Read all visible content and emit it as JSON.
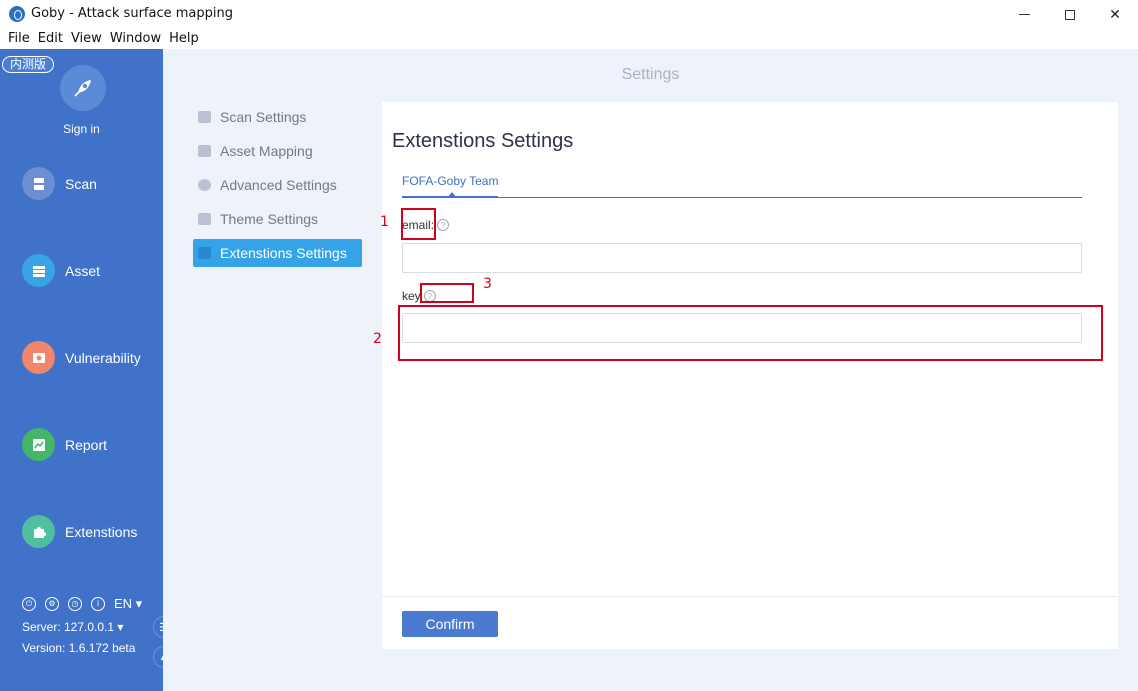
{
  "window": {
    "title": "Goby - Attack surface mapping",
    "controls": {
      "minimize": "─",
      "maximize": "☐",
      "close": "✕"
    }
  },
  "menubar": [
    "File",
    "Edit",
    "View",
    "Window",
    "Help"
  ],
  "sidebar": {
    "badge": "内测版",
    "signin": "Sign in",
    "nav": [
      {
        "label": "Scan",
        "icon": "scan-icon",
        "color": "#6b8fd0"
      },
      {
        "label": "Asset",
        "icon": "asset-icon",
        "color": "#3aa3e6"
      },
      {
        "label": "Vulnerability",
        "icon": "vulnerability-icon",
        "color": "#f0866a"
      },
      {
        "label": "Report",
        "icon": "report-icon",
        "color": "#45b56a"
      },
      {
        "label": "Extenstions",
        "icon": "extensions-icon",
        "color": "#4fbf9f"
      }
    ],
    "tools": {
      "language": "EN"
    },
    "server": "Server: 127.0.0.1",
    "version": "Version: 1.6.172 beta"
  },
  "main": {
    "page_title": "Settings",
    "subnav": [
      {
        "label": "Scan Settings",
        "active": false
      },
      {
        "label": "Asset Mapping",
        "active": false
      },
      {
        "label": "Advanced Settings",
        "active": false
      },
      {
        "label": "Theme Settings",
        "active": false
      },
      {
        "label": "Extenstions Settings",
        "active": true
      }
    ],
    "card": {
      "title": "Extenstions Settings",
      "tab": "FOFA-Goby Team",
      "email_label": "email",
      "email_value": "",
      "key_label": "key",
      "key_value": "",
      "confirm": "Confirm"
    }
  },
  "annotations": [
    "1",
    "2",
    "3"
  ],
  "colors": {
    "sidebar": "#3f72c8",
    "active_subnav": "#35a3e8",
    "annotation_red": "#d0021b"
  }
}
